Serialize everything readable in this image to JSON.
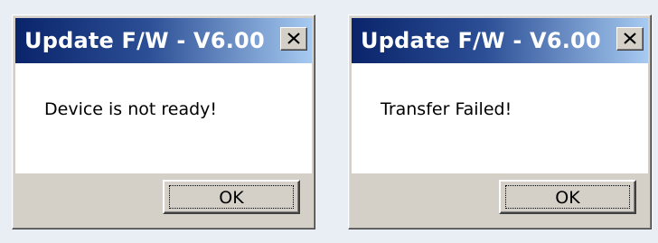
{
  "dialogs": [
    {
      "title": "Update F/W - V6.00",
      "message": "Device is not ready!",
      "ok_label": "OK",
      "close_icon": "close-icon"
    },
    {
      "title": "Update F/W - V6.00",
      "message": "Transfer Failed!",
      "ok_label": "OK",
      "close_icon": "close-icon"
    }
  ],
  "colors": {
    "titlebar_start": "#0a246a",
    "titlebar_end": "#a6caf0",
    "dialog_face": "#d4d0c8",
    "page_background": "#e9eef4"
  }
}
